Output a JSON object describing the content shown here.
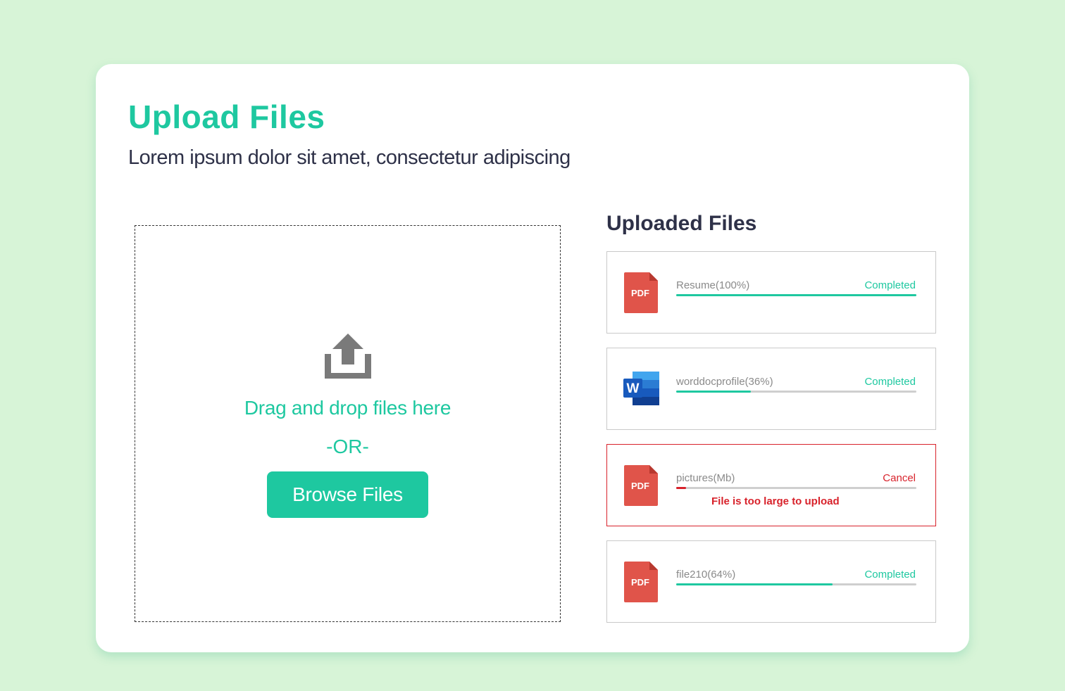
{
  "header": {
    "title": "Upload Files",
    "subtitle": "Lorem ipsum dolor sit amet, consectetur adipiscing"
  },
  "dropzone": {
    "icon": "upload-icon",
    "drag_text": "Drag and drop files here",
    "or_text": "-OR-",
    "browse_label": "Browse Files"
  },
  "uploaded": {
    "heading": "Uploaded Files",
    "files": [
      {
        "name": "Resume(100%)",
        "status": "Completed",
        "progress": 1.0,
        "icon": "pdf-file-icon",
        "icon_label": "PDF",
        "error": ""
      },
      {
        "name": "worddocprofile(36%)",
        "status": "Completed",
        "progress": 0.31,
        "icon": "word-file-icon",
        "icon_label": "W",
        "error": ""
      },
      {
        "name": "pictures(Mb)",
        "status": "Cancel",
        "progress": 0.04,
        "icon": "pdf-file-icon",
        "icon_label": "PDF",
        "error": "File is too large to upload"
      },
      {
        "name": "file210(64%)",
        "status": "Completed",
        "progress": 0.65,
        "icon": "pdf-file-icon",
        "icon_label": "PDF",
        "error": ""
      }
    ]
  },
  "colors": {
    "background": "#d7f4d7",
    "accent": "#1ec8a0",
    "text_dark": "#2e3148",
    "error": "#d8222b",
    "pdf_red": "#e0544a",
    "word_blue": "#185abd"
  }
}
